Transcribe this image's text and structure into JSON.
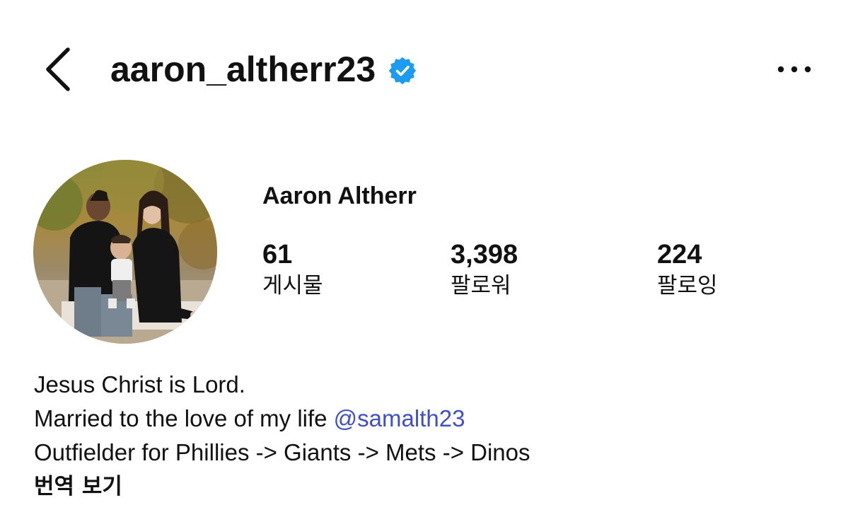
{
  "header": {
    "username": "aaron_altherr23",
    "verified": true,
    "icons": {
      "back": "chevron-left-icon",
      "verified": "verified-badge-icon",
      "more": "more-horizontal-icon"
    },
    "accent_color": "#1d9bf0"
  },
  "profile": {
    "display_name": "Aaron Altherr",
    "stats": [
      {
        "value": "61",
        "label": "게시물"
      },
      {
        "value": "3,398",
        "label": "팔로워"
      },
      {
        "value": "224",
        "label": "팔로잉"
      }
    ]
  },
  "bio": {
    "line1": "Jesus Christ is Lord.",
    "line2_text": "Married to the love of my life ",
    "line2_mention": "@samalth23",
    "line3": "Outfielder for Phillies -> Giants -> Mets -> Dinos",
    "translate_label": "번역 보기",
    "mention_color": "#3f4fc5"
  }
}
